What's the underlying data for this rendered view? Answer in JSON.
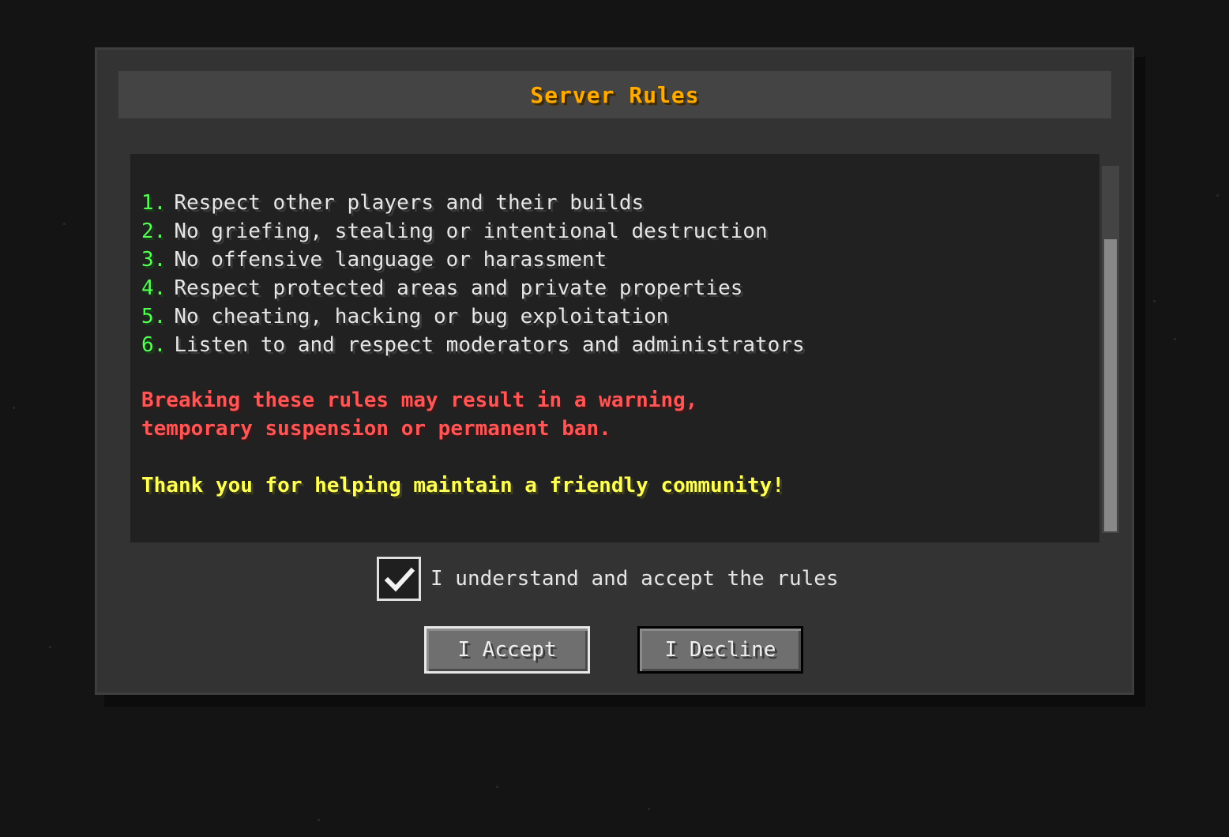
{
  "dialog": {
    "title": "Server Rules",
    "rules": [
      {
        "num": "1.",
        "text": "Respect other players and their builds"
      },
      {
        "num": "2.",
        "text": "No griefing, stealing or intentional destruction"
      },
      {
        "num": "3.",
        "text": "No offensive language or harassment"
      },
      {
        "num": "4.",
        "text": "Respect protected areas and private properties"
      },
      {
        "num": "5.",
        "text": "No cheating, hacking or bug exploitation"
      },
      {
        "num": "6.",
        "text": "Listen to and respect moderators and administrators"
      }
    ],
    "warning_line1": "Breaking these rules may result in a warning,",
    "warning_line2": "temporary suspension or permanent ban.",
    "thanks": "Thank you for helping maintain a friendly community!",
    "checkbox": {
      "label": "I understand and accept the rules",
      "checked": true
    },
    "accept_label": "I Accept",
    "decline_label": "I Decline"
  },
  "colors": {
    "title": "#ffaa00",
    "rule_number": "#55ff55",
    "warning": "#ff5555",
    "thanks": "#ffff55",
    "background": "#141414"
  },
  "icons": {
    "check": "check-icon"
  }
}
